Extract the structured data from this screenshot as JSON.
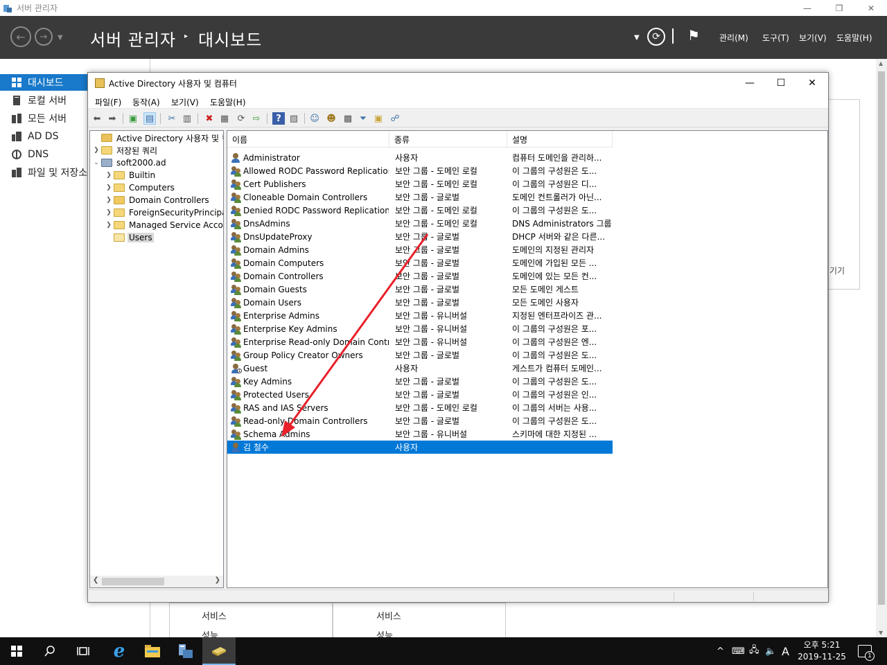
{
  "server_manager": {
    "window_title": "서버 관리자",
    "breadcrumb_root": "서버 관리자",
    "breadcrumb_page": "대시보드",
    "menu": [
      "관리(M)",
      "도구(T)",
      "보기(V)",
      "도움말(H)"
    ],
    "nav": [
      "대시보드",
      "로컬 서버",
      "모든 서버",
      "AD DS",
      "DNS",
      "파일 및 저장소"
    ],
    "right_panel_text": "기기",
    "bottom_labels": [
      "서비스",
      "성능",
      "서비스",
      "성능"
    ]
  },
  "ad_window": {
    "title": "Active Directory 사용자 및 컴퓨터",
    "menu": [
      "파일(F)",
      "동작(A)",
      "보기(V)",
      "도움말(H)"
    ],
    "tree": {
      "root": "Active Directory 사용자 및 컴퓨터",
      "saved_queries": "저장된 쿼리",
      "domain": "soft2000.ad",
      "children": [
        "Builtin",
        "Computers",
        "Domain Controllers",
        "ForeignSecurityPrincipals",
        "Managed Service Accounts",
        "Users"
      ]
    },
    "columns": [
      "이름",
      "종류",
      "설명"
    ],
    "rows": [
      {
        "name": "Administrator",
        "type": "사용자",
        "desc": "컴퓨터 도메인을 관리하...",
        "icon": "user"
      },
      {
        "name": "Allowed RODC Password Replication ...",
        "type": "보안 그룹 - 도메인 로컬",
        "desc": "이 그룹의 구성원은 도...",
        "icon": "group"
      },
      {
        "name": "Cert Publishers",
        "type": "보안 그룹 - 도메인 로컬",
        "desc": "이 그룹의 구성원은 디...",
        "icon": "group"
      },
      {
        "name": "Cloneable Domain Controllers",
        "type": "보안 그룹 - 글로벌",
        "desc": "도메인 컨트롤러가 아닌...",
        "icon": "group"
      },
      {
        "name": "Denied RODC Password Replication ...",
        "type": "보안 그룹 - 도메인 로컬",
        "desc": "이 그룹의 구성원은 도...",
        "icon": "group"
      },
      {
        "name": "DnsAdmins",
        "type": "보안 그룹 - 도메인 로컬",
        "desc": "DNS Administrators 그룹",
        "icon": "group"
      },
      {
        "name": "DnsUpdateProxy",
        "type": "보안 그룹 - 글로벌",
        "desc": "DHCP 서버와 같은 다른...",
        "icon": "group"
      },
      {
        "name": "Domain Admins",
        "type": "보안 그룹 - 글로벌",
        "desc": "도메인의 지정된 관리자",
        "icon": "group"
      },
      {
        "name": "Domain Computers",
        "type": "보안 그룹 - 글로벌",
        "desc": "도메인에 가입된 모든 ...",
        "icon": "group"
      },
      {
        "name": "Domain Controllers",
        "type": "보안 그룹 - 글로벌",
        "desc": "도메인에 있는 모든 컨...",
        "icon": "group"
      },
      {
        "name": "Domain Guests",
        "type": "보안 그룹 - 글로벌",
        "desc": "모든 도메인 게스트",
        "icon": "group"
      },
      {
        "name": "Domain Users",
        "type": "보안 그룹 - 글로벌",
        "desc": "모든 도메인 사용자",
        "icon": "group"
      },
      {
        "name": "Enterprise Admins",
        "type": "보안 그룹 - 유니버설",
        "desc": "지정된 엔터프라이즈 관...",
        "icon": "group"
      },
      {
        "name": "Enterprise Key Admins",
        "type": "보안 그룹 - 유니버설",
        "desc": "이 그룹의 구성원은 포...",
        "icon": "group"
      },
      {
        "name": "Enterprise Read-only Domain Control...",
        "type": "보안 그룹 - 유니버설",
        "desc": "이 그룹의 구성원은 엔...",
        "icon": "group"
      },
      {
        "name": "Group Policy Creator Owners",
        "type": "보안 그룹 - 글로벌",
        "desc": "이 그룹의 구성원은 도...",
        "icon": "group"
      },
      {
        "name": "Guest",
        "type": "사용자",
        "desc": "게스트가 컴퓨터 도메인...",
        "icon": "user-disabled"
      },
      {
        "name": "Key Admins",
        "type": "보안 그룹 - 글로벌",
        "desc": "이 그룹의 구성원은 도...",
        "icon": "group"
      },
      {
        "name": "Protected Users",
        "type": "보안 그룹 - 글로벌",
        "desc": "이 그룹의 구성원은 인...",
        "icon": "group"
      },
      {
        "name": "RAS and IAS Servers",
        "type": "보안 그룹 - 도메인 로컬",
        "desc": "이 그룹의 서버는 사용...",
        "icon": "group"
      },
      {
        "name": "Read-only Domain Controllers",
        "type": "보안 그룹 - 글로벌",
        "desc": "이 그룹의 구성원은 도...",
        "icon": "group"
      },
      {
        "name": "Schema Admins",
        "type": "보안 그룹 - 유니버설",
        "desc": "스키마에 대한 지정된 ...",
        "icon": "group"
      },
      {
        "name": "김 철수",
        "type": "사용자",
        "desc": "",
        "icon": "user",
        "selected": true
      }
    ]
  },
  "taskbar": {
    "time": "오후 5:21",
    "date": "2019-11-25",
    "ime": "A",
    "notifications": "1"
  },
  "colors": {
    "selection": "#0078d7",
    "nav_active": "#1979ca",
    "header_bg": "#3a3a3a",
    "annotation_arrow": "#e8202a"
  }
}
